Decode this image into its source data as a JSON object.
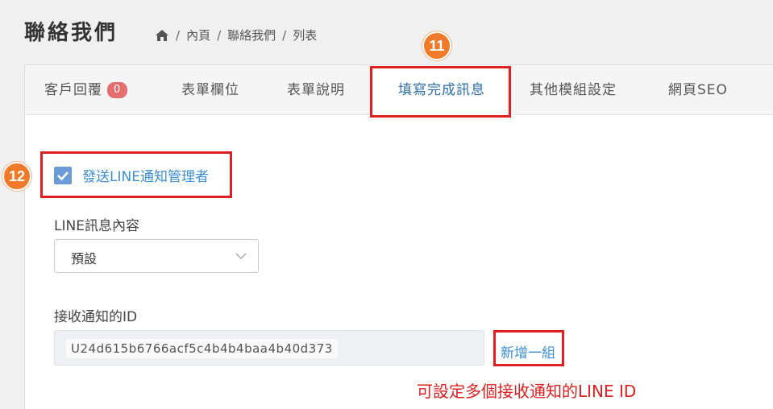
{
  "page": {
    "title": "聯絡我們",
    "breadcrumb": [
      "內頁",
      "聯絡我們",
      "列表"
    ]
  },
  "tabs": [
    {
      "label": "客戶回覆",
      "badge": "0"
    },
    {
      "label": "表單欄位"
    },
    {
      "label": "表單說明"
    },
    {
      "label": "填寫完成訊息",
      "active": true
    },
    {
      "label": "其他模組設定"
    },
    {
      "label": "網頁SEO"
    }
  ],
  "annotations": {
    "step11": "11",
    "step12": "12",
    "note": "可設定多個接收通知的LINE ID"
  },
  "form": {
    "notify_checkbox": {
      "label": "發送LINE通知管理者",
      "checked": true
    },
    "line_message": {
      "label": "LINE訊息內容",
      "selected": "預設"
    },
    "receiver_ids": {
      "label": "接收通知的ID",
      "value": "U24d615b6766acf5c4b4b4baa4b40d373",
      "add_label": "新增一組"
    }
  },
  "colors": {
    "accent": "#3a8fd6",
    "highlight": "#e02020",
    "badge": "#e56f6f",
    "step": "#f07a2a"
  }
}
